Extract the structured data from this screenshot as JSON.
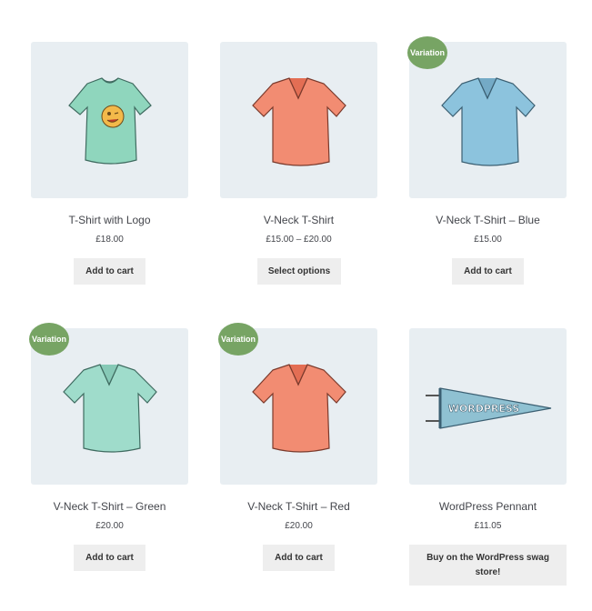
{
  "products": [
    {
      "title": "T-Shirt with Logo",
      "price": "£18.00",
      "button": "Add to cart",
      "badge": "",
      "image": "tshirt-logo",
      "color": "#8fd6bd"
    },
    {
      "title": "V-Neck T-Shirt",
      "price": "£15.00 – £20.00",
      "button": "Select options",
      "badge": "",
      "image": "vneck",
      "color": "#f28c72"
    },
    {
      "title": "V-Neck T-Shirt – Blue",
      "price": "£15.00",
      "button": "Add to cart",
      "badge": "Variation",
      "image": "vneck",
      "color": "#8cc3dd"
    },
    {
      "title": "V-Neck T-Shirt – Green",
      "price": "£20.00",
      "button": "Add to cart",
      "badge": "Variation",
      "image": "vneck",
      "color": "#9fdccb"
    },
    {
      "title": "V-Neck T-Shirt – Red",
      "price": "£20.00",
      "button": "Add to cart",
      "badge": "Variation",
      "image": "vneck",
      "color": "#f28c72"
    },
    {
      "title": "WordPress Pennant",
      "price": "£11.05",
      "button": "Buy on the WordPress swag store!",
      "badge": "",
      "image": "pennant",
      "color": "#8fc1d2"
    }
  ],
  "pennant_text": "WORDPRESS",
  "colors": {
    "badge": "#77a464",
    "thumb_bg": "#e8eef2",
    "button_bg": "#eeeeee"
  }
}
